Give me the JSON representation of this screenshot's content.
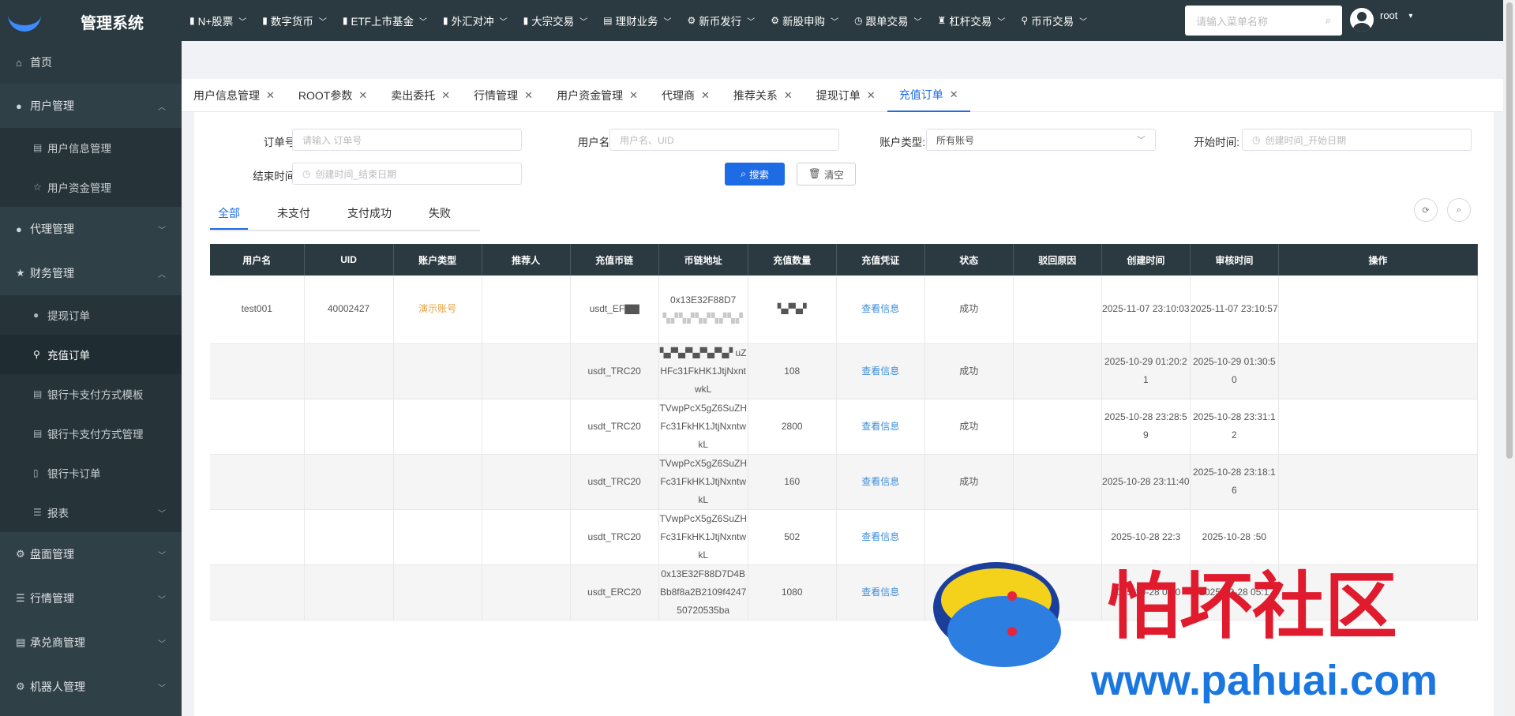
{
  "app": {
    "title": "管理系统"
  },
  "topnav": [
    {
      "icon": "bar-chart-icon",
      "glyph": "▮",
      "label": "N+股票"
    },
    {
      "icon": "bar-chart-icon",
      "glyph": "▮",
      "label": "数字货币"
    },
    {
      "icon": "bar-chart-icon",
      "glyph": "▮",
      "label": "ETF上市基金"
    },
    {
      "icon": "bar-chart-icon",
      "glyph": "▮",
      "label": "外汇对冲"
    },
    {
      "icon": "bar-chart-icon",
      "glyph": "▮",
      "label": "大宗交易"
    },
    {
      "icon": "document-icon",
      "glyph": "▤",
      "label": "理财业务"
    },
    {
      "icon": "gear-icon",
      "glyph": "⚙",
      "label": "新币发行"
    },
    {
      "icon": "gear-icon",
      "glyph": "⚙",
      "label": "新股申购"
    },
    {
      "icon": "clock-icon",
      "glyph": "◷",
      "label": "跟单交易"
    },
    {
      "icon": "trophy-icon",
      "glyph": "♜",
      "label": "杠杆交易"
    },
    {
      "icon": "location-icon",
      "glyph": "⚲",
      "label": "币币交易"
    }
  ],
  "menu_search": {
    "placeholder": "请输入菜单名称"
  },
  "user": {
    "name": "root"
  },
  "sidebar": {
    "home": "首页",
    "user_mgmt": "用户管理",
    "user_info": "用户信息管理",
    "user_funds": "用户资金管理",
    "agent_mgmt": "代理管理",
    "finance_mgmt": "财务管理",
    "withdraw_orders": "提现订单",
    "recharge_orders": "充值订单",
    "bank_tpl": "银行卡支付方式模板",
    "bank_mgmt": "银行卡支付方式管理",
    "bank_orders": "银行卡订单",
    "reports": "报表",
    "market_mgmt": "盘面管理",
    "quote_mgmt": "行情管理",
    "acceptor_mgmt": "承兑商管理",
    "robot_mgmt": "机器人管理"
  },
  "tabs": [
    "用户信息管理",
    "ROOT参数",
    "卖出委托",
    "行情管理",
    "用户资金管理",
    "代理商",
    "推荐关系",
    "提现订单",
    "充值订单"
  ],
  "filters": {
    "order_no_label": "订单号:",
    "order_no_placeholder": "请输入 订单号",
    "username_label": "用户名:",
    "username_placeholder": "用户名、UID",
    "acct_type_label": "账户类型:",
    "acct_type_value": "所有账号",
    "start_label": "开始时间:",
    "start_placeholder": "创建时间_开始日期",
    "end_label": "结束时间:",
    "end_placeholder": "创建时间_结束日期",
    "search_btn": "搜索",
    "clear_btn": "清空"
  },
  "status_tabs": [
    "全部",
    "未支付",
    "支付成功",
    "失败"
  ],
  "table": {
    "headers": [
      "用户名",
      "UID",
      "账户类型",
      "推荐人",
      "充值币链",
      "币链地址",
      "充值数量",
      "充值凭证",
      "状态",
      "驳回原因",
      "创建时间",
      "审核时间",
      "操作"
    ],
    "rows": [
      {
        "user": "test001",
        "uid": "40002427",
        "acct": "演示账号",
        "ref": "",
        "chain": "usdt_EF▇▇",
        "addr": "0x13E32F88D7",
        "addr_blur": "▚▞▚▞▚▞▚▞▚▞",
        "qty": "▚▞▚▞",
        "voucher": "查看信息",
        "status": "成功",
        "reject": "",
        "created": "2025-11-07 23:10:03",
        "audited": "2025-11-07 23:10:57"
      },
      {
        "user": "",
        "uid": "",
        "acct": "",
        "ref": "",
        "chain": "usdt_TRC20",
        "addr": "▚▞▚▞▚▞▚▞▚▞ uZHFc31FkHK1JtjNxntwkL",
        "qty": "108",
        "voucher": "查看信息",
        "status": "成功",
        "reject": "",
        "created": "2025-10-29 01:20:21",
        "audited": "2025-10-29 01:30:50"
      },
      {
        "user": "",
        "uid": "",
        "acct": "",
        "ref": "",
        "chain": "usdt_TRC20",
        "addr": "TVwpPcX5gZ6SuZHFc31FkHK1JtjNxntwkL",
        "qty": "2800",
        "voucher": "查看信息",
        "status": "成功",
        "reject": "",
        "created": "2025-10-28 23:28:59",
        "audited": "2025-10-28 23:31:12"
      },
      {
        "user": "",
        "uid": "",
        "acct": "",
        "ref": "",
        "chain": "usdt_TRC20",
        "addr": "TVwpPcX5gZ6SuZHFc31FkHK1JtjNxntwkL",
        "qty": "160",
        "voucher": "查看信息",
        "status": "成功",
        "reject": "",
        "created": "2025-10-28 23:11:40",
        "audited": "2025-10-28 23:18:16"
      },
      {
        "user": "",
        "uid": "",
        "acct": "",
        "ref": "",
        "chain": "usdt_TRC20",
        "addr": "TVwpPcX5gZ6SuZHFc31FkHK1JtjNxntwkL",
        "qty": "502",
        "voucher": "查看信息",
        "status": "",
        "reject": "",
        "created": "2025-10-28 22:3",
        "audited": "2025-10-28 :50"
      },
      {
        "user": "",
        "uid": "",
        "acct": "",
        "ref": "",
        "chain": "usdt_ERC20",
        "addr": "0x13E32F88D7D4BBb8f8a2B2109f424750720535ba",
        "qty": "1080",
        "voucher": "查看信息",
        "status": "",
        "reject": "",
        "created": "2025-10-28 05:0",
        "audited": "2025-10-28 05:1"
      }
    ]
  },
  "watermark": {
    "cn": "怕坏社区",
    "url": "www.pahuai.com"
  },
  "colors": {
    "topbar": "#2b3a40",
    "sidebar": "#304047",
    "accent": "#1e6be6",
    "demo_account": "#e4a23e",
    "link": "#3f8ed9"
  }
}
